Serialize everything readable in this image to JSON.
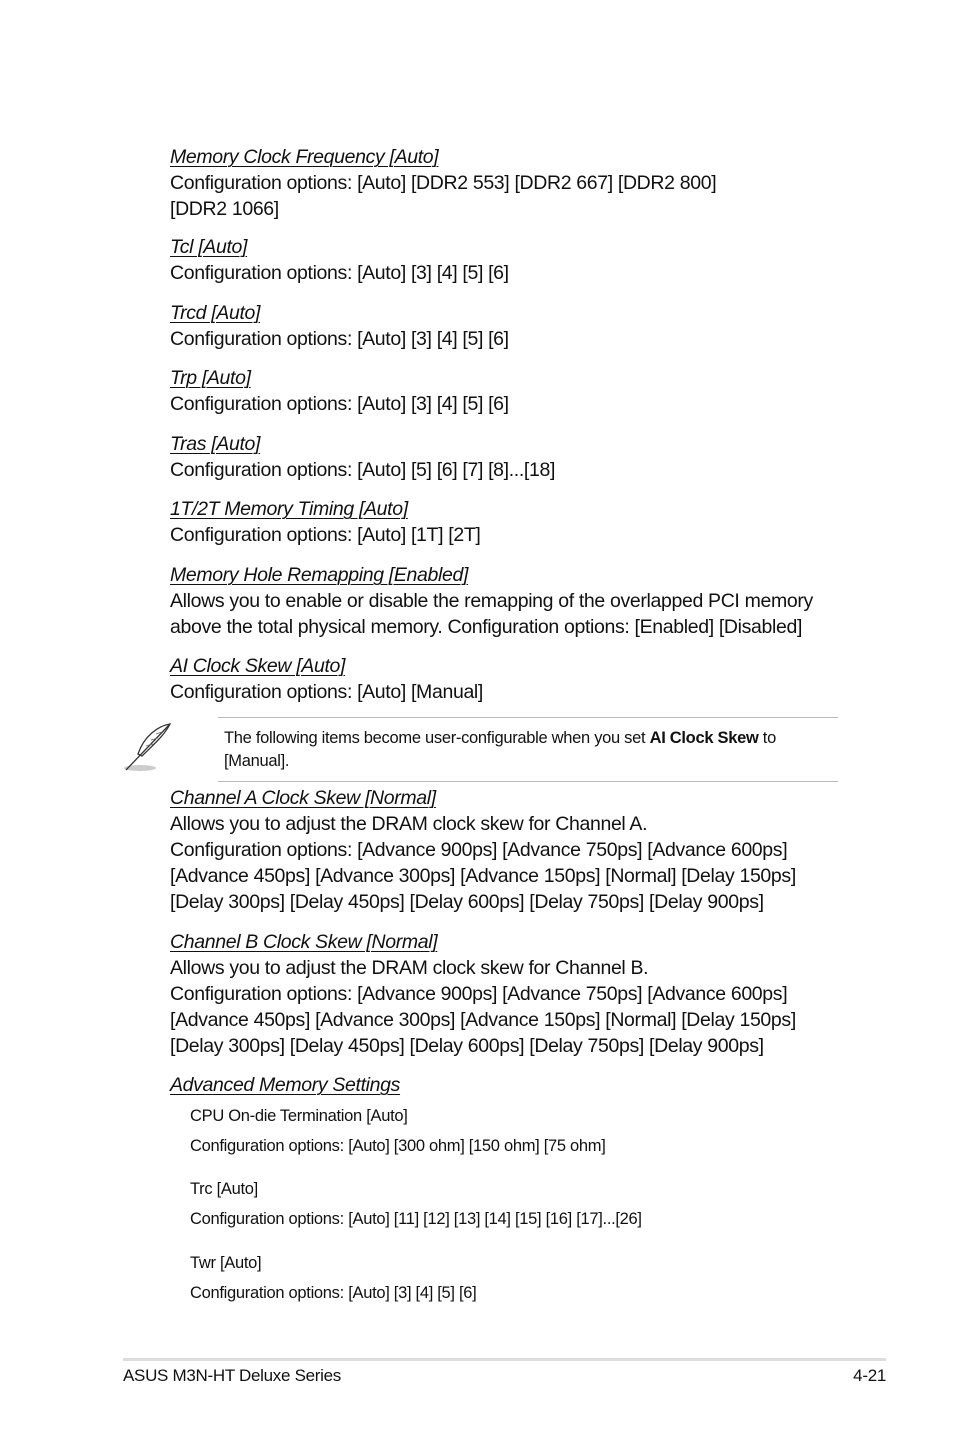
{
  "items": [
    {
      "title": "Memory Clock Frequency [Auto]",
      "lines": [
        "Configuration options: [Auto] [DDR2 553] [DDR2 667] [DDR2 800]",
        "[DDR2 1066]"
      ]
    },
    {
      "title": "Tcl [Auto]",
      "lines": [
        "Configuration options: [Auto] [3] [4] [5] [6]"
      ]
    },
    {
      "title": "Trcd [Auto] ",
      "lines": [
        "Configuration options: [Auto] [3] [4] [5] [6]"
      ]
    },
    {
      "title": "Trp [Auto] ",
      "lines": [
        "Configuration options: [Auto] [3] [4] [5] [6]"
      ]
    },
    {
      "title": "Tras [Auto] ",
      "lines": [
        "Configuration options: [Auto] [5] [6] [7] [8]...[18]"
      ]
    },
    {
      "title": "1T/2T Memory Timing [Auto]",
      "lines": [
        "Configuration options: [Auto] [1T] [2T]"
      ]
    },
    {
      "title": "Memory Hole Remapping [Enabled]",
      "lines": [
        "Allows you to enable or disable the remapping of the overlapped PCI memory",
        "above the total physical memory. Configuration options: [Enabled] [Disabled]"
      ]
    },
    {
      "title": "AI Clock Skew [Auto]",
      "lines": [
        "Configuration options: [Auto] [Manual]"
      ]
    },
    {
      "title": "Channel A Clock Skew [Normal]",
      "lines": [
        "Allows you to adjust the DRAM clock skew for Channel A.",
        "Configuration options: [Advance 900ps] [Advance 750ps] [Advance 600ps]",
        "[Advance 450ps] [Advance 300ps] [Advance 150ps] [Normal] [Delay 150ps]",
        "[Delay 300ps] [Delay 450ps] [Delay 600ps] [Delay 750ps] [Delay 900ps]"
      ]
    },
    {
      "title": "Channel B Clock Skew [Normal]",
      "lines": [
        "Allows you to adjust the DRAM clock skew for Channel B.",
        "Configuration options: [Advance 900ps] [Advance 750ps] [Advance 600ps]",
        "[Advance 450ps] [Advance 300ps] [Advance 150ps] [Normal] [Delay 150ps]",
        "[Delay 300ps] [Delay 450ps] [Delay 600ps] [Delay 750ps] [Delay 900ps]"
      ]
    },
    {
      "title": "Advanced Memory Settings",
      "lines": []
    }
  ],
  "note": {
    "icon": "feather-pen-icon",
    "before": "The following items become user-configurable when you set ",
    "bold": "AI Clock Skew",
    "after": " to [Manual]."
  },
  "sub_items": [
    {
      "title": "CPU On-die Termination [Auto]",
      "options": "Configuration options: [Auto] [300 ohm] [150 ohm] [75 ohm]"
    },
    {
      "title": "Trc [Auto]",
      "options": "Configuration options: [Auto] [11] [12] [13] [14] [15] [16] [17]...[26]"
    },
    {
      "title": "Twr [Auto]",
      "options": "Configuration options: [Auto] [3] [4] [5] [6]"
    }
  ],
  "footer": {
    "left": "ASUS M3N-HT Deluxe Series",
    "right": "4-21"
  }
}
